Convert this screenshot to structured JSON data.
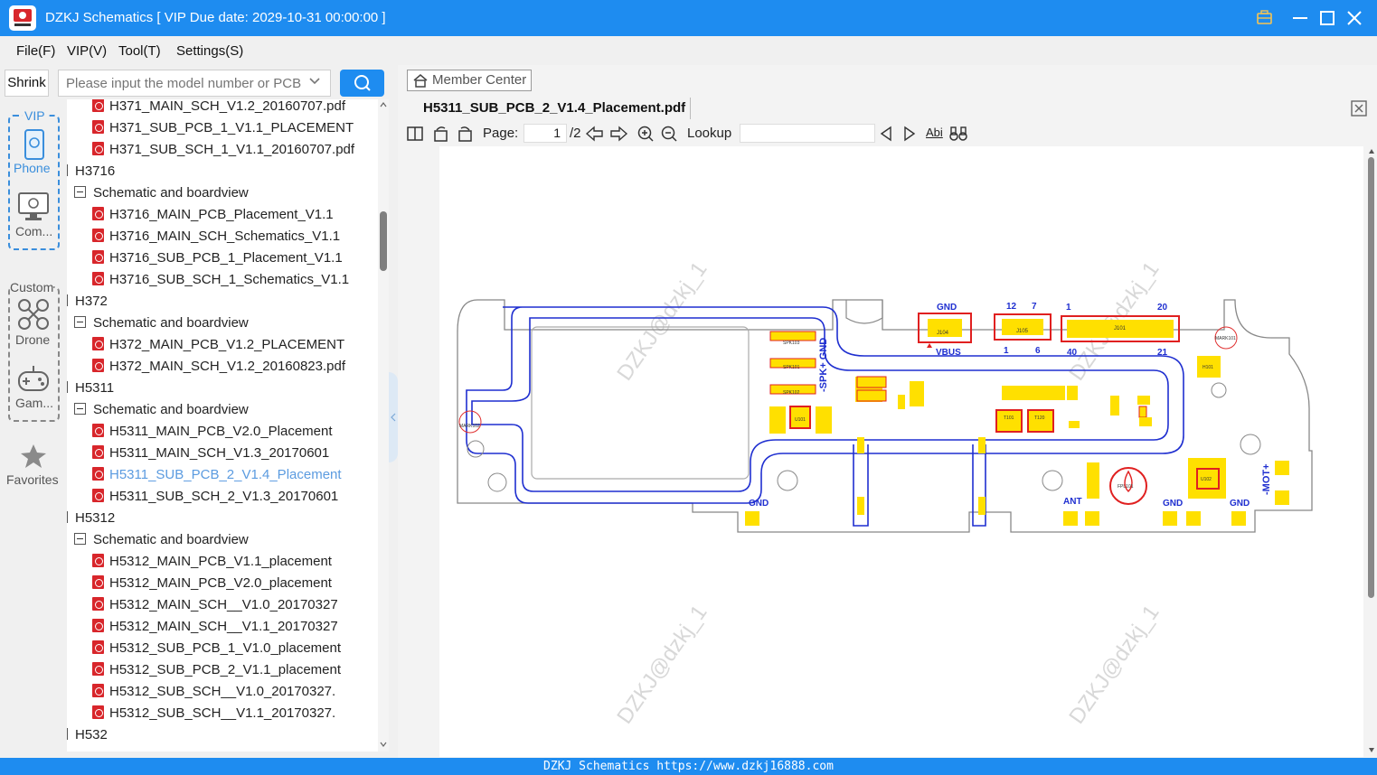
{
  "window": {
    "title": "DZKJ Schematics [ VIP Due date: 2029-10-31 00:00:00 ]"
  },
  "menu": [
    "File(F)",
    "VIP(V)",
    "Tool(T)",
    "Settings(S)"
  ],
  "left": {
    "shrink_label": "Shrink",
    "search_placeholder": "Please input the model number or PCB"
  },
  "side": {
    "vip_label": "VIP",
    "phone_label": "Phone",
    "computer_label": "Com...",
    "custom_label": "Custom",
    "drone_label": "Drone",
    "game_label": "Gam...",
    "favorites_label": "Favorites"
  },
  "tree": [
    {
      "level": 2,
      "kind": "pdf",
      "text": "H371_MAIN_SCH_V1.2_20160707.pdf"
    },
    {
      "level": 2,
      "kind": "pdf",
      "text": "H371_SUB_PCB_1_V1.1_PLACEMENT"
    },
    {
      "level": 2,
      "kind": "pdf",
      "text": "H371_SUB_SCH_1_V1.1_20160707.pdf"
    },
    {
      "level": 0,
      "kind": "group",
      "text": "H3716"
    },
    {
      "level": 1,
      "kind": "group",
      "text": "Schematic and boardview"
    },
    {
      "level": 2,
      "kind": "pdf",
      "text": "H3716_MAIN_PCB_Placement_V1.1"
    },
    {
      "level": 2,
      "kind": "pdf",
      "text": "H3716_MAIN_SCH_Schematics_V1.1"
    },
    {
      "level": 2,
      "kind": "pdf",
      "text": "H3716_SUB_PCB_1_Placement_V1.1"
    },
    {
      "level": 2,
      "kind": "pdf",
      "text": "H3716_SUB_SCH_1_Schematics_V1.1"
    },
    {
      "level": 0,
      "kind": "group",
      "text": "H372"
    },
    {
      "level": 1,
      "kind": "group",
      "text": "Schematic and boardview"
    },
    {
      "level": 2,
      "kind": "pdf",
      "text": "H372_MAIN_PCB_V1.2_PLACEMENT"
    },
    {
      "level": 2,
      "kind": "pdf",
      "text": "H372_MAIN_SCH_V1.2_20160823.pdf"
    },
    {
      "level": 0,
      "kind": "group",
      "text": "H5311"
    },
    {
      "level": 1,
      "kind": "group",
      "text": "Schematic and boardview"
    },
    {
      "level": 2,
      "kind": "pdf",
      "text": "H5311_MAIN_PCB_V2.0_Placement"
    },
    {
      "level": 2,
      "kind": "pdf",
      "text": "H5311_MAIN_SCH_V1.3_20170601"
    },
    {
      "level": 2,
      "kind": "pdf",
      "text": "H5311_SUB_PCB_2_V1.4_Placement",
      "selected": true
    },
    {
      "level": 2,
      "kind": "pdf",
      "text": "H5311_SUB_SCH_2_V1.3_20170601"
    },
    {
      "level": 0,
      "kind": "group",
      "text": "H5312"
    },
    {
      "level": 1,
      "kind": "group",
      "text": "Schematic and boardview"
    },
    {
      "level": 2,
      "kind": "pdf",
      "text": "H5312_MAIN_PCB_V1.1_placement"
    },
    {
      "level": 2,
      "kind": "pdf",
      "text": "H5312_MAIN_PCB_V2.0_placement"
    },
    {
      "level": 2,
      "kind": "pdf",
      "text": "H5312_MAIN_SCH__V1.0_20170327"
    },
    {
      "level": 2,
      "kind": "pdf",
      "text": "H5312_MAIN_SCH__V1.1_20170327"
    },
    {
      "level": 2,
      "kind": "pdf",
      "text": "H5312_SUB_PCB_1_V1.0_placement"
    },
    {
      "level": 2,
      "kind": "pdf",
      "text": "H5312_SUB_PCB_2_V1.1_placement"
    },
    {
      "level": 2,
      "kind": "pdf",
      "text": "H5312_SUB_SCH__V1.0_20170327."
    },
    {
      "level": 2,
      "kind": "pdf",
      "text": "H5312_SUB_SCH__V1.1_20170327."
    },
    {
      "level": 0,
      "kind": "group",
      "text": "H532"
    }
  ],
  "viewer": {
    "member_center": "Member Center",
    "tab_title": "H5311_SUB_PCB_2_V1.4_Placement.pdf",
    "page_label": "Page:",
    "page_current": "1",
    "page_total": "/2",
    "lookup_label": "Lookup",
    "lookup_value": "",
    "abi_label": "Abi",
    "watermark": "DZKJ@dzkj_1"
  },
  "board": {
    "labels": {
      "gnd_top": "GND",
      "vbus": "VBUS",
      "j104": "J104",
      "j105": "J105",
      "j101": "J101",
      "n12": "12",
      "n7": "7",
      "n1a": "1",
      "n6": "6",
      "n1b": "1",
      "n20": "20",
      "n40": "40",
      "n21": "21",
      "spk": "-SPK+ GND",
      "spk103": "SPK103",
      "spk101": "SPK101",
      "spk102": "SPK102",
      "u101": "U101",
      "u102": "U102",
      "t101": "T101",
      "t120": "T120",
      "mark101": "MARK101",
      "mark102": "MARK102",
      "h101": "H101",
      "mot": "-MOT+",
      "gnd1": "GND",
      "ant": "ANT",
      "gnd2": "GND",
      "gnd3": "GND",
      "fpl101": "FPL101"
    }
  },
  "status": "DZKJ Schematics https://www.dzkj16888.com"
}
